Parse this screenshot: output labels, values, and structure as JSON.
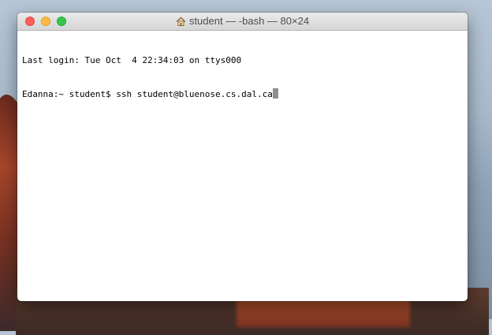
{
  "window": {
    "title": "student — -bash — 80×24",
    "title_icon": "home-icon"
  },
  "terminal": {
    "lines": [
      "Last login: Tue Oct  4 22:34:03 on ttys000",
      "Edanna:~ student$ ssh student@bluenose.cs.dal.ca"
    ]
  },
  "colors": {
    "close": "#fc605c",
    "minimize": "#fdbc40",
    "maximize": "#34c84a",
    "cursor": "#8e8e8e"
  }
}
